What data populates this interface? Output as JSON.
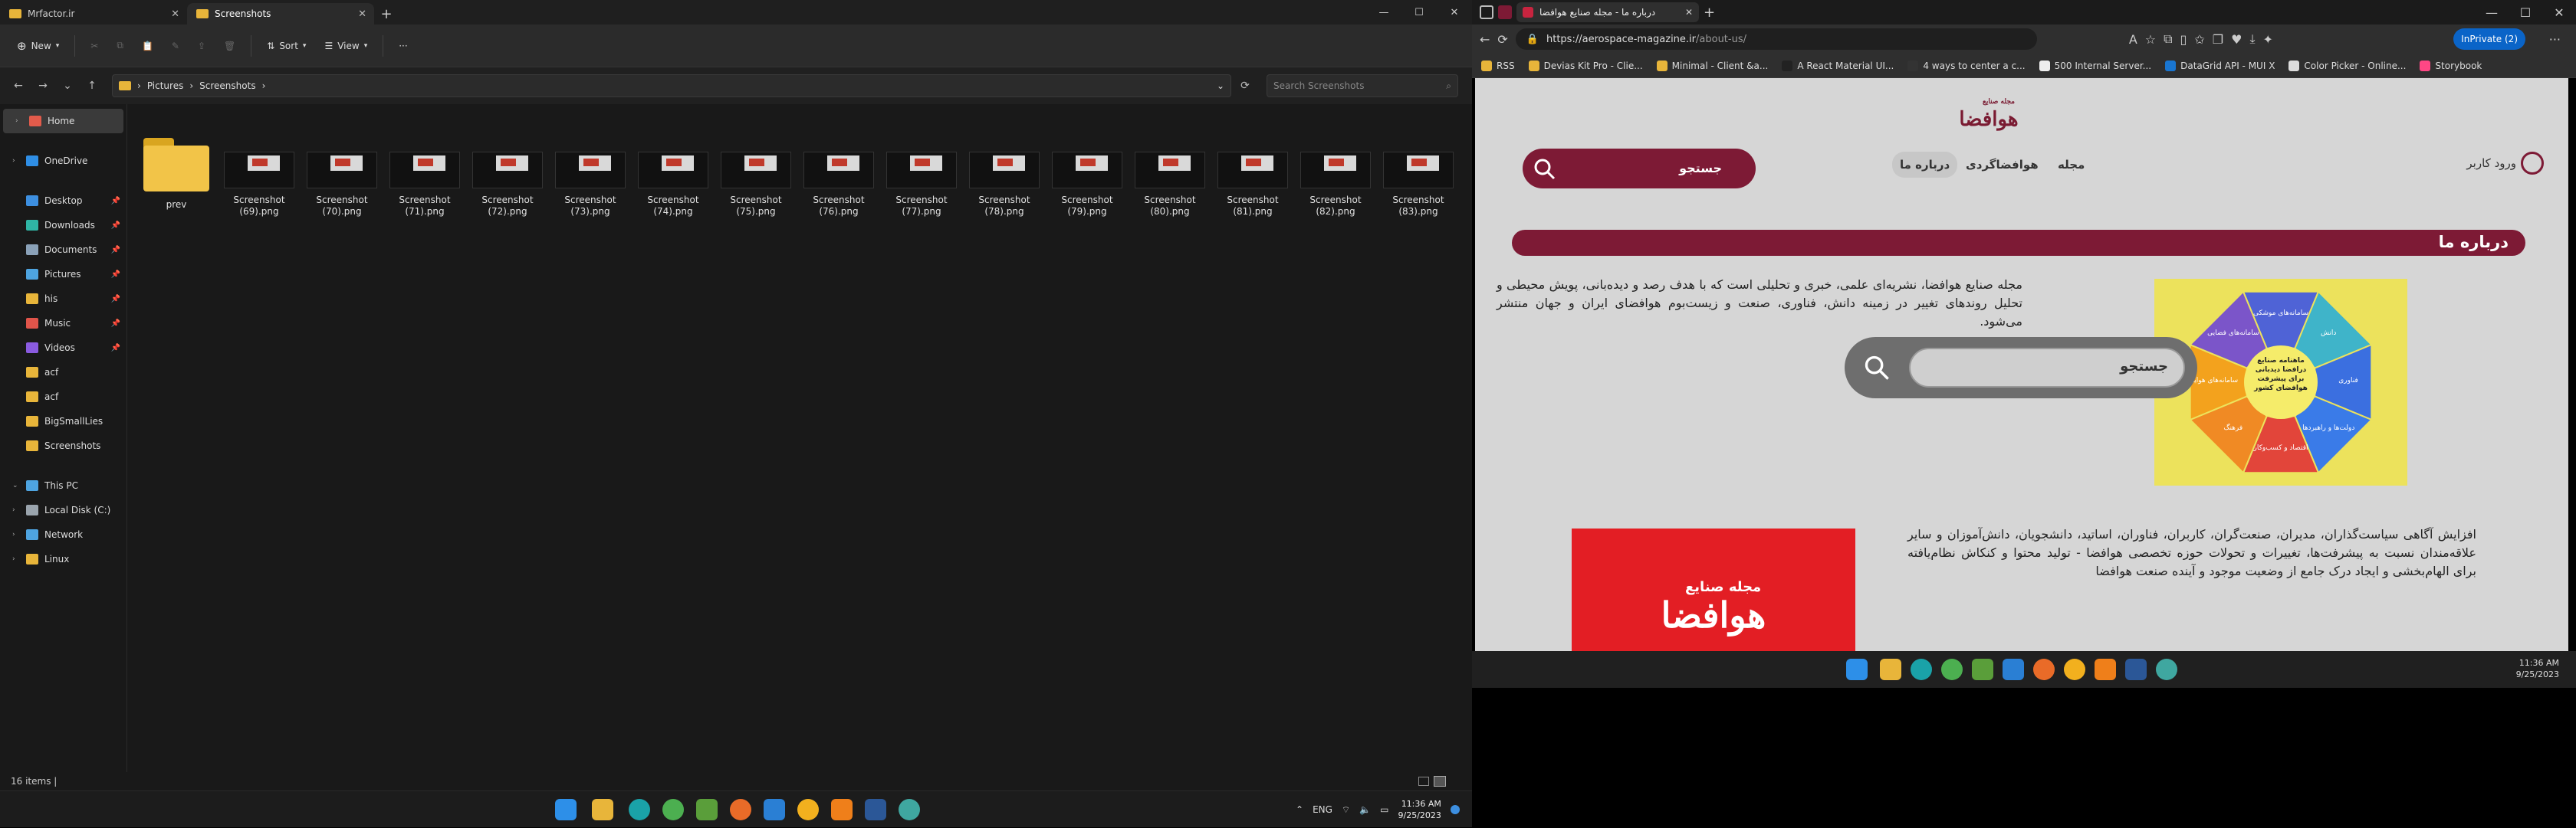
{
  "explorer": {
    "tabs": [
      {
        "label": "Mrfactor.ir"
      },
      {
        "label": "Screenshots"
      }
    ],
    "new_tab": "+",
    "window_controls": {
      "minimize": "—",
      "maximize": "☐",
      "close": "✕"
    },
    "toolbar": {
      "new_label": "New",
      "sort_label": "Sort",
      "view_label": "View",
      "more_label": "···"
    },
    "address": {
      "segments": [
        "Pictures",
        "Screenshots"
      ],
      "separator": "›"
    },
    "search_placeholder": "Search Screenshots",
    "nav": [
      {
        "label": "Home",
        "color": "#e25b4b",
        "selected": true,
        "chevron": "›"
      },
      {
        "label": "OneDrive",
        "color": "#2f8ee5",
        "chevron": "›"
      },
      {
        "label": "Desktop",
        "color": "#3d8fe0",
        "pinned": true
      },
      {
        "label": "Downloads",
        "color": "#2fb5a5",
        "pinned": true
      },
      {
        "label": "Documents",
        "color": "#8aa1b8",
        "pinned": true
      },
      {
        "label": "Pictures",
        "color": "#4ea4e0",
        "pinned": true
      },
      {
        "label": "his",
        "color": "#e8b53a",
        "pinned": true
      },
      {
        "label": "Music",
        "color": "#e0544a",
        "pinned": true
      },
      {
        "label": "Videos",
        "color": "#8a5be0",
        "pinned": true
      },
      {
        "label": "acf",
        "color": "#e8b53a"
      },
      {
        "label": "acf",
        "color": "#e8b53a"
      },
      {
        "label": "BigSmallLies",
        "color": "#e8b53a"
      },
      {
        "label": "Screenshots",
        "color": "#e8b53a"
      },
      {
        "label": "This PC",
        "color": "#4ea4e0",
        "chevron": "⌄"
      },
      {
        "label": "Local Disk (C:)",
        "color": "#9aa4ad",
        "chevron": "›"
      },
      {
        "label": "Network",
        "color": "#4ea4e0",
        "chevron": "›"
      },
      {
        "label": "Linux",
        "color": "#e8b53a",
        "chevron": "›"
      }
    ],
    "files": [
      {
        "name": "prev",
        "type": "folder"
      },
      {
        "name": "Screenshot (69).png"
      },
      {
        "name": "Screenshot (70).png"
      },
      {
        "name": "Screenshot (71).png"
      },
      {
        "name": "Screenshot (72).png"
      },
      {
        "name": "Screenshot (73).png"
      },
      {
        "name": "Screenshot (74).png"
      },
      {
        "name": "Screenshot (75).png"
      },
      {
        "name": "Screenshot (76).png"
      },
      {
        "name": "Screenshot (77).png"
      },
      {
        "name": "Screenshot (78).png"
      },
      {
        "name": "Screenshot (79).png"
      },
      {
        "name": "Screenshot (80).png"
      },
      {
        "name": "Screenshot (81).png"
      },
      {
        "name": "Screenshot (82).png"
      },
      {
        "name": "Screenshot (83).png"
      }
    ],
    "status": "16 items  |"
  },
  "taskbar_left": {
    "lang": "ENG",
    "time": "11:36 AM",
    "date": "9/25/2023"
  },
  "edge": {
    "tab_title": "درباره ما - مجله صنایع هوافضا",
    "new_tab": "+",
    "url_host": "https://aerospace-magazine.ir",
    "url_path": "/about-us/",
    "inprivate": "InPrivate (2)",
    "favorites": [
      {
        "label": "RSS",
        "color": "#e8b53a"
      },
      {
        "label": "Devias Kit Pro - Clie...",
        "color": "#e8b53a"
      },
      {
        "label": "Minimal - Client &a...",
        "color": "#e8b53a"
      },
      {
        "label": "A React Material UI...",
        "color": "#222222"
      },
      {
        "label": "4 ways to center a c...",
        "color": "#333333"
      },
      {
        "label": "500 Internal Server...",
        "color": "#eeeeee"
      },
      {
        "label": "DataGrid API - MUI X",
        "color": "#1976d2"
      },
      {
        "label": "Color Picker - Online...",
        "color": "#dddddd"
      },
      {
        "label": "Storybook",
        "color": "#ff4785"
      }
    ]
  },
  "site": {
    "logo_text": "هوافضا",
    "logo_small": "مجله صنایع",
    "search_text": "جستجو",
    "menu": [
      "مجله",
      "هوافضاگردی",
      "درباره ما"
    ],
    "login": "ورود کاربر",
    "section_title": "درباره ما",
    "para1": "مجله صنایع هوافضا، نشریه‌ای علمی، خبری و تحلیلی است که با هدف رصد و دیده‌بانی، پویش محیطی و تحلیل روندهای تغییر در زمینه دانش، فناوری، صنعت و زیست‌بوم هوافضای ایران و جهان منتشر می‌شود.",
    "para2": "افزایش آگاهی سیاست‌گذاران، مدیران، صنعت‌گران، کاربران، فناوران، اساتید، دانشجویان، دانش‌آموزان و سایر علاقه‌مندان نسبت به پیشرفت‌ها، تغییرات و تحولات حوزه تخصصی هوافضا - تولید محتوا و کنکاش نظام‌یافته برای الهام‌بخشی و ایجاد درک جامع از وضعیت موجود و آینده صنعت هوافضا",
    "overlay_search": "جستجو",
    "diagram": {
      "center": "ماهنامه صنایع درافضا دیدبانی برای پیشرفت هوافضای کشور",
      "segments": [
        {
          "label": "سامانه‌های موشکی",
          "color": "#4f63d6"
        },
        {
          "label": "دانش",
          "color": "#3fb4c9"
        },
        {
          "label": "فناوری",
          "color": "#3b6fe0"
        },
        {
          "label": "دولت‌ها و راهبردها",
          "color": "#3a7be8"
        },
        {
          "label": "اقتصاد و کسب‌وکار",
          "color": "#e2453a"
        },
        {
          "label": "فرهنگ",
          "color": "#f08a24"
        },
        {
          "label": "سامانه‌های هوایی",
          "color": "#f3a21d"
        },
        {
          "label": "سامانه‌های فضایی",
          "color": "#7b55c9"
        }
      ]
    },
    "redbox_title": "هوافضا",
    "redbox_small": "مجله صنایع"
  },
  "taskbar_right": {
    "time": "11:36 AM",
    "date": "9/25/2023"
  }
}
